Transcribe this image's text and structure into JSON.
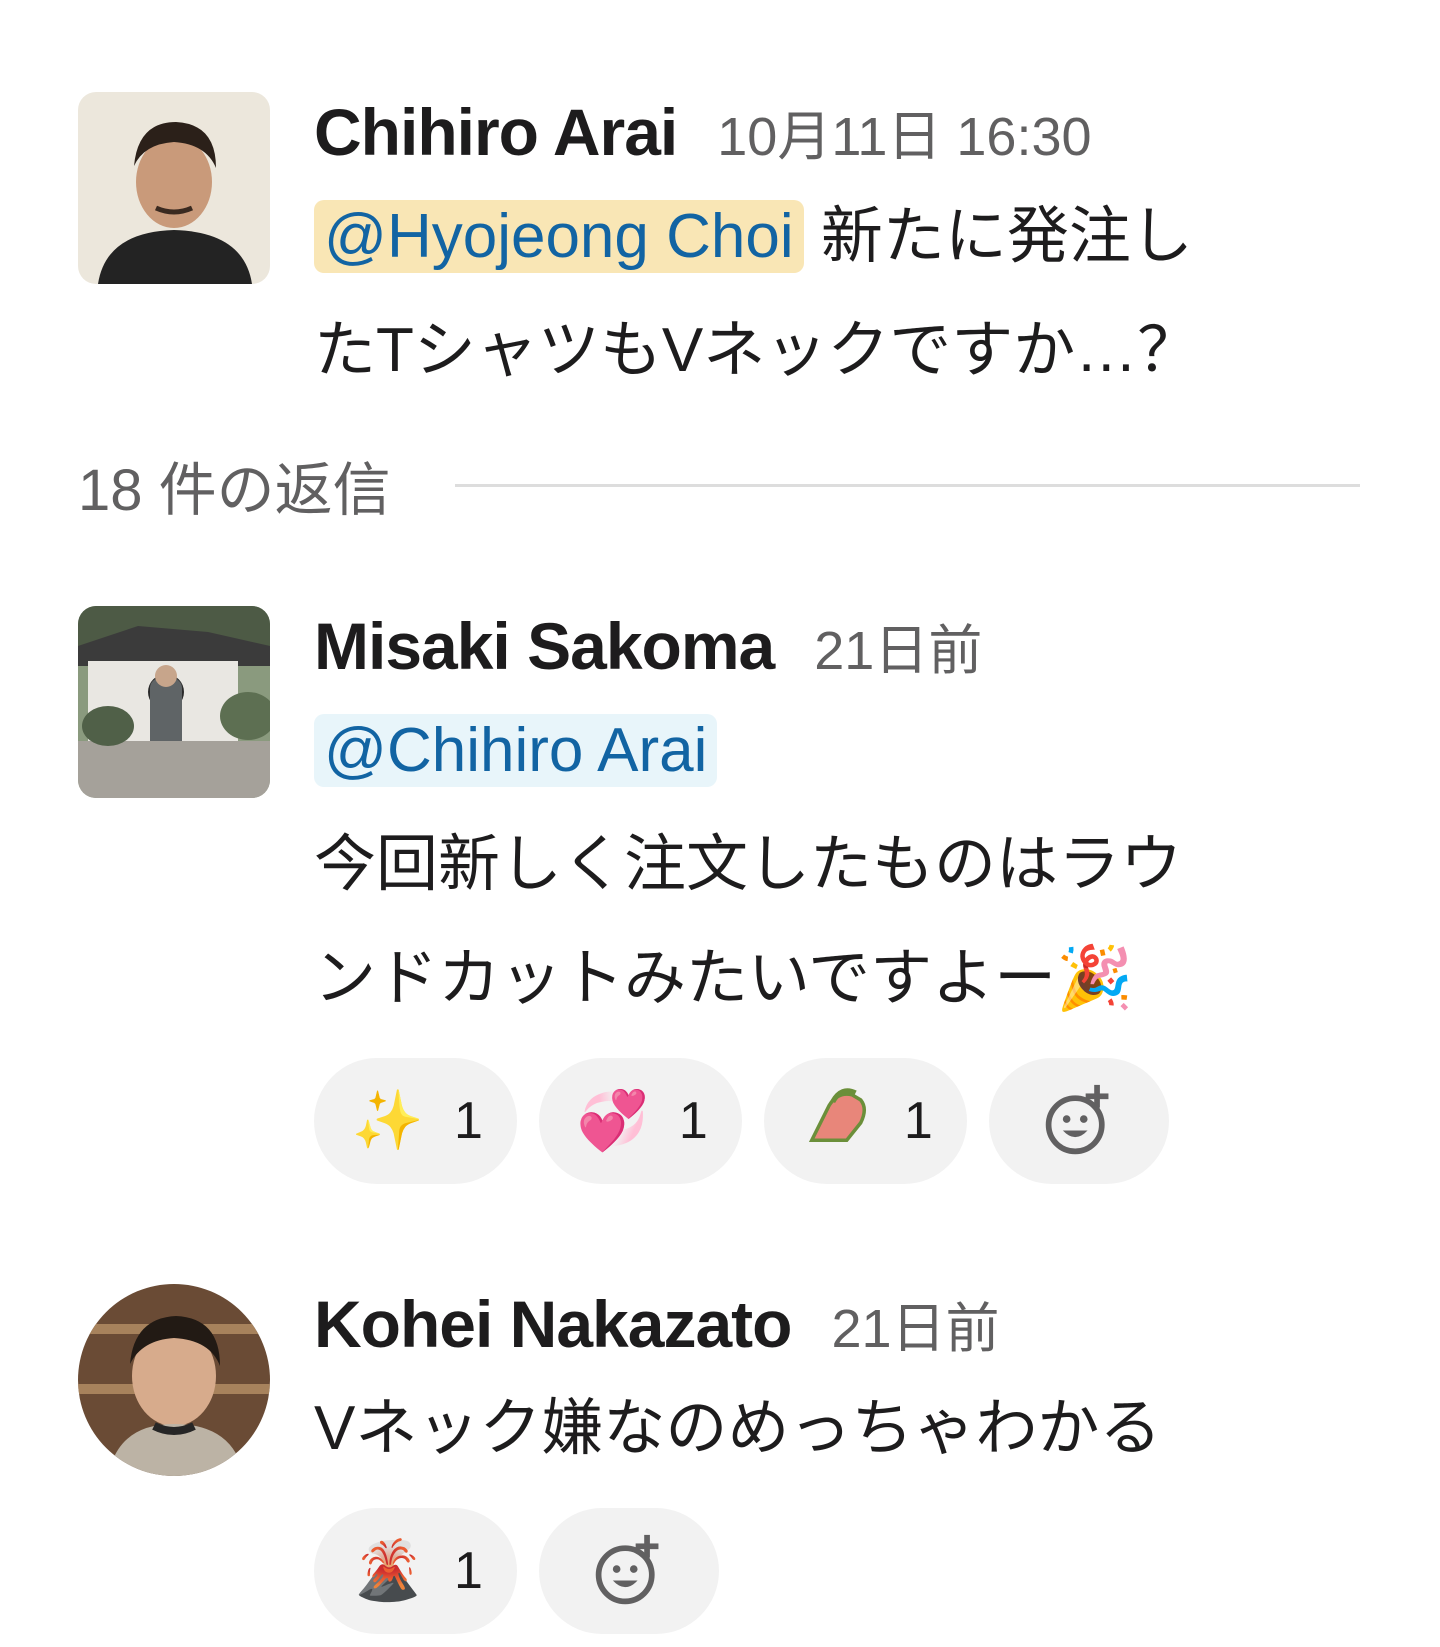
{
  "messages": [
    {
      "author": "Chihiro Arai",
      "timestamp": "10月11日 16:30",
      "mention": "@Hyojeong Choi",
      "text_line1": " 新たに発注し",
      "text_line2": "たTシャツもVネックですか…？"
    },
    {
      "author": "Misaki Sakoma",
      "timestamp": "21日前",
      "mention": "@Chihiro Arai",
      "text_line1": "今回新しく注文したものはラウ",
      "text_line2": "ンドカットみたいですよー",
      "text_emoji": "🎉",
      "reactions": [
        {
          "emoji": "✨",
          "icon": "sparkles-icon",
          "count": "1"
        },
        {
          "emoji": "💞",
          "icon": "revolving-hearts-icon",
          "count": "1"
        },
        {
          "emoji": "🤏",
          "icon": "custom-emoji-icon",
          "count": "1"
        }
      ]
    },
    {
      "author": "Kohei Nakazato",
      "timestamp": "21日前",
      "text_line1": "Vネック嫌なのめっちゃわかる",
      "reactions": [
        {
          "emoji": "🌋",
          "icon": "volcano-icon",
          "count": "1"
        }
      ]
    }
  ],
  "thread": {
    "reply_count_label": "18 件の返信"
  },
  "colors": {
    "mention_text": "#1264a3",
    "mention_alert_bg": "#f9e6b5",
    "mention_bg": "#e8f5fa",
    "reaction_bg": "#f2f2f2"
  }
}
